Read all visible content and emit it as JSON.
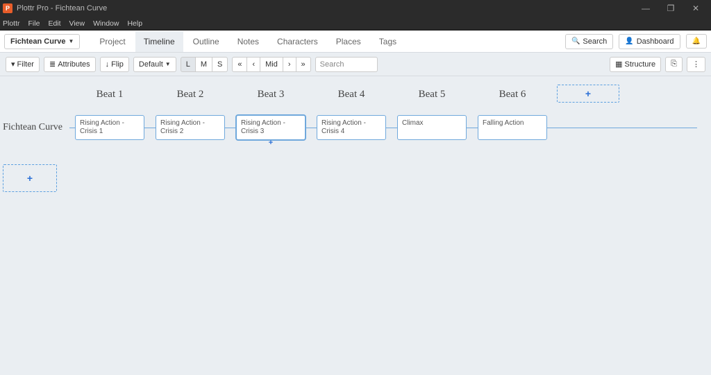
{
  "window": {
    "app_icon_letter": "P",
    "title": "Plottr Pro - Fichtean Curve",
    "controls": {
      "min": "—",
      "max": "❐",
      "close": "✕"
    }
  },
  "menubar": [
    "Plottr",
    "File",
    "Edit",
    "View",
    "Window",
    "Help"
  ],
  "topnav": {
    "doc_name": "Fichtean Curve",
    "tabs": [
      "Project",
      "Timeline",
      "Outline",
      "Notes",
      "Characters",
      "Places",
      "Tags"
    ],
    "active_tab_index": 1,
    "search_label": "Search",
    "dashboard_label": "Dashboard",
    "bell": "🔔"
  },
  "toolbar": {
    "filter_label": "Filter",
    "attributes_label": "Attributes",
    "flip_label": "Flip",
    "default_label": "Default",
    "zoom": [
      "L",
      "M",
      "S"
    ],
    "zoom_active_index": 0,
    "nav": [
      "«",
      "‹",
      "Mid",
      "›",
      "»"
    ],
    "search_placeholder": "Search",
    "structure_label": "Structure",
    "export_icon": "⎘",
    "more_icon": "⋮"
  },
  "timeline": {
    "beats": [
      "Beat 1",
      "Beat 2",
      "Beat 3",
      "Beat 4",
      "Beat 5",
      "Beat 6"
    ],
    "add_chapter": "+",
    "row_name": "Fichtean Curve",
    "cards": [
      "Rising Action - Crisis 1",
      "Rising Action - Crisis 2",
      "Rising Action - Crisis 3",
      "Rising Action - Crisis 4",
      "Climax",
      "Falling Action"
    ],
    "selected_card_index": 2,
    "add_below": "+",
    "add_row": "+"
  }
}
